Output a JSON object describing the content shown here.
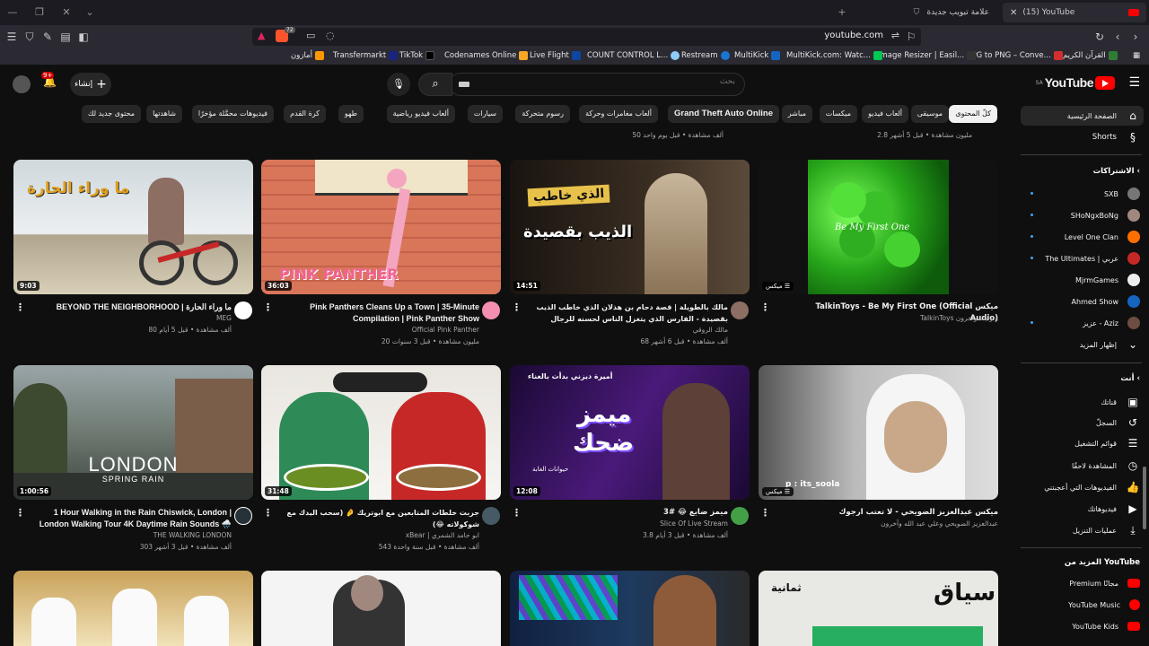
{
  "browser": {
    "tabs": [
      {
        "title": "(15) YouTube",
        "active": true
      },
      {
        "title": "علامة تبويب جديدة",
        "active": false
      }
    ],
    "shield_count": "72",
    "url": "youtube.com",
    "bookmarks": [
      {
        "label": "القرآن الكريم",
        "color": "#2e7d32"
      },
      {
        "label": "JPG to PNG – Conve...",
        "color": "#d32f2f"
      },
      {
        "label": "Image Resizer | Easil...",
        "color": "#333"
      },
      {
        "label": "MultiKick.com: Watc...",
        "color": "#00c853"
      },
      {
        "label": "MultiKick",
        "color": "#1565c0"
      },
      {
        "label": "Restream",
        "color": "#1976d2"
      },
      {
        "label": "COUNT CONTROL L...",
        "color": "#90caf9"
      },
      {
        "label": "Live Flight",
        "color": "#0d47a1"
      },
      {
        "label": "Codenames Online",
        "color": "#f9a825"
      },
      {
        "label": "TikTok",
        "color": "#000"
      },
      {
        "label": "Transfermarkt",
        "color": "#1a237e"
      },
      {
        "label": "أمازون",
        "color": "#ff9800"
      }
    ]
  },
  "yt_header": {
    "logo_text": "YouTube",
    "logo_country": "SA",
    "search_placeholder": "بحث",
    "create_label": "إنشاء",
    "notif_count": "9+"
  },
  "chips": [
    "كلّ المحتوى",
    "موسيقى",
    "ألعاب فيديو",
    "ميكسات",
    "مباشر",
    "Grand Theft Auto Online",
    "ألعاب مغامرات وحركة",
    "رسوم متحركة",
    "سيارات",
    "ألعاب فيديو رياضية",
    "طهو",
    "كرة القدم",
    "فيديوهات محمَّلة مؤخرًا",
    "شاهدتها",
    "محتوى جديد لك"
  ],
  "prev_row": [
    {
      "meta": "2.8 مليون مشاهدة • قبل 5 أشهر"
    },
    {
      "meta": "50 ألف مشاهدة • قبل يوم واحد"
    }
  ],
  "videos": [
    {
      "title": "ميكس TalkinToys - Be My First One (Official Audio)",
      "channel": "TalkinToys وتوايت وآخرون",
      "meta": "",
      "badge": "ميكس",
      "ltr": false,
      "thumb": "clover"
    },
    {
      "title": "مالك بالطويلة | قصة دحام بن هذلان الذي خاطب الذيب بقصيدة - الفارس الذي يتغزل الناس لحسنه للرجال",
      "channel": "مالك الروقي",
      "meta": "68 ألف مشاهدة • قبل 6 أشهر",
      "duration": "14:51",
      "ltr": false,
      "thumb": "poet"
    },
    {
      "title": "Pink Panthers Cleans Up a Town | 35-Minute Compilation | Pink Panther Show",
      "channel": "Official Pink Panther",
      "meta": "20 مليون مشاهدة • قبل 3 سنوات",
      "duration": "36:03",
      "ltr": true,
      "thumb": "panther"
    },
    {
      "title": "BEYOND THE NEIGHBORHOOD | ما وراء الحارة",
      "channel": "MEG",
      "meta": "80 ألف مشاهدة • قبل 5 أيام",
      "duration": "9:03",
      "ltr": true,
      "thumb": "bike"
    },
    {
      "title": "ميكس عبدالعزيز الضويحي - لا تعتب ارجوك",
      "channel": "عبدالعزيز الضويحي وعلي عبد الله وآخرون",
      "meta": "",
      "badge": "ميكس",
      "ltr": false,
      "thumb": "singer"
    },
    {
      "title": "ميمز ضايع 😂 #3",
      "channel": "Slice Of Live Stream",
      "meta": "3.8 ألف مشاهدة • قبل 3 أيام",
      "duration": "12:08",
      "ltr": false,
      "thumb": "memes"
    },
    {
      "title": "جربت خلطات المتابعين مع ابوتريك 🤌 (سحب اليدك مع شوكولاته 😂)",
      "channel": "xBear | ابو حامد الشمري",
      "meta": "543 ألف مشاهدة • قبل سنة واحدة",
      "duration": "31:48",
      "ltr": false,
      "thumb": "food"
    },
    {
      "title": "1 Hour Walking in the Rain Chiswick, London | London Walking Tour 4K Daytime Rain Sounds 🌧️",
      "channel": "THE WALKING LONDON",
      "meta": "303 ألف مشاهدة • قبل 3 أشهر",
      "duration": "1:00:56",
      "ltr": true,
      "thumb": "london"
    }
  ],
  "thumb_text": {
    "bike_ar": "ما وراء الحارة",
    "panther": "PINK PANTHER",
    "poet_1": "الذي خاطب",
    "poet_2": "الذيب بقصيدة",
    "clover": "Be My First One",
    "london_1": "LONDON",
    "london_2": "SPRING RAIN",
    "memes_1": "ميمز",
    "memes_2": "ضحك",
    "memes_top": "أميرة ديزني بدأت بالغناء",
    "memes_bottom": "حيوانات الغابة",
    "singer_handle": "p : its_soola",
    "row3_a": "ثمانية",
    "row3_b": "سياق"
  },
  "sidebar": {
    "home": "الصفحة الرئيسية",
    "shorts": "Shorts",
    "subs_title": "الاشتراكات",
    "subscriptions": [
      {
        "name": "SXB",
        "color": "#777"
      },
      {
        "name": "SHoNgxBoNg",
        "color": "#a1887f"
      },
      {
        "name": "Level One Clan",
        "color": "#ff6f00"
      },
      {
        "name": "The Ultimates | عربي",
        "color": "#c62828"
      },
      {
        "name": "MjrmGames",
        "color": "#eee"
      },
      {
        "name": "Ahmed Show",
        "color": "#1565c0"
      },
      {
        "name": "عزيز - Aziz",
        "color": "#6d4c41"
      }
    ],
    "show_more": "إظهار المزيد",
    "you_title": "أنت",
    "you_items": [
      {
        "label": "قناتك",
        "icon": "▣"
      },
      {
        "label": "السجلّ",
        "icon": "↺"
      },
      {
        "label": "قوائم التشغيل",
        "icon": "☰"
      },
      {
        "label": "المشاهدة لاحقًا",
        "icon": "◷"
      },
      {
        "label": "الفيديوهات التي أعجبتني",
        "icon": "👍"
      },
      {
        "label": "فيديوهاتك",
        "icon": "▶"
      },
      {
        "label": "عمليات التنزيل",
        "icon": "⤓"
      }
    ],
    "more_title": "المزيد من YouTube",
    "more_items": [
      {
        "label": "Premium مجانًا",
        "color": "#ff0000"
      },
      {
        "label": "YouTube Music",
        "color": "#ff0000"
      },
      {
        "label": "YouTube Kids",
        "color": "#ff0000"
      }
    ]
  }
}
